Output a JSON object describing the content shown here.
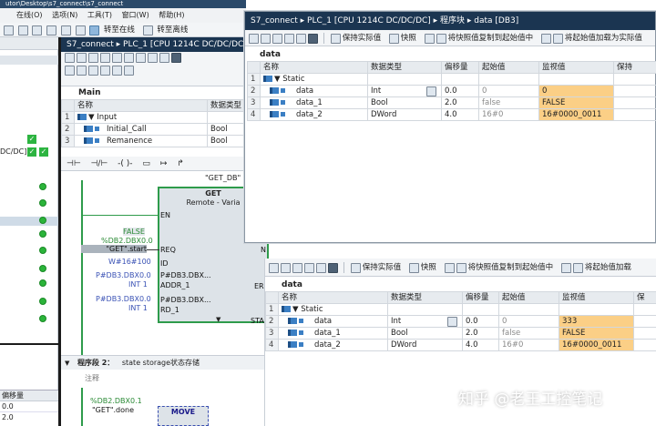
{
  "main_window": {
    "path_text": "utor\\Desktop\\s7_connect\\s7_connect",
    "menu": [
      "在线(O)",
      "选项(N)",
      "工具(T)",
      "窗口(W)",
      "帮助(H)"
    ],
    "toolbar_buttons": [
      "转至在线",
      "转至离线",
      "转至"
    ],
    "breadcrumb": "S7_connect ▸ PLC_1 [CPU 1214C DC/DC/DC]",
    "left_device_label": "DC/DC]",
    "block_title": "Main",
    "interface_headers": [
      "名称",
      "数据类型"
    ],
    "interface_rows": [
      {
        "num": "1",
        "name": "▼ Input",
        "type": ""
      },
      {
        "num": "2",
        "name": "Initial_Call",
        "type": "Bool"
      },
      {
        "num": "3",
        "name": "Remanence",
        "type": "Bool"
      }
    ],
    "lad_symbols": [
      "⊣⊢",
      "⊣/⊢",
      "-( )-",
      "▭",
      "↦",
      "↱"
    ],
    "get_block": {
      "instance": "\"GET_DB\"",
      "name": "GET",
      "subtitle": "Remote - Varia",
      "en": "EN",
      "req_value": "FALSE",
      "req_addr": "%DB2.DBX0.0",
      "req_tag": "\"GET\".start",
      "req": "REQ",
      "id_value": "W#16#100",
      "id": "ID",
      "addr_ptr": "P#DB3.DBX0.0",
      "addr_ptr2": "P#DB3.DBX...",
      "addr_type": "INT 1",
      "addr": "ADDR_1",
      "rd_ptr": "P#DB3.DBX0.0",
      "rd_ptr2": "P#DB3.DBX...",
      "rd_type": "INT 1",
      "rd": "RD_1",
      "err": "ERI",
      "sta": "STA",
      "n_out": "N"
    },
    "network2": {
      "title": "程序段 2：",
      "comment_text": "state storage状态存储",
      "comment_placeholder": "注释",
      "done_addr": "%DB2.DBX0.1",
      "done_tag": "\"GET\".done",
      "move": "MOVE"
    },
    "bottom_left_headers": [
      "偏移量"
    ],
    "bottom_left_values": [
      "0.0",
      "2.0"
    ]
  },
  "db_window_1": {
    "title": "S7_connect ▸ PLC_1 [CPU 1214C DC/DC/DC] ▸ 程序块 ▸ data [DB3]",
    "toolbar": [
      "保持实际值",
      "快照",
      "将快照值复制到起始值中",
      "将起始值加载为实际值"
    ],
    "db_name": "data",
    "headers": [
      "名称",
      "数据类型",
      "偏移量",
      "起始值",
      "监视值",
      "保持"
    ],
    "rows": [
      {
        "num": "1",
        "name": "▼ Static",
        "type": "",
        "offset": "",
        "start": "",
        "monitor": ""
      },
      {
        "num": "2",
        "name": "data",
        "type": "Int",
        "offset": "0.0",
        "start": "0",
        "monitor": "0"
      },
      {
        "num": "3",
        "name": "data_1",
        "type": "Bool",
        "offset": "2.0",
        "start": "false",
        "monitor": "FALSE"
      },
      {
        "num": "4",
        "name": "data_2",
        "type": "DWord",
        "offset": "4.0",
        "start": "16#0",
        "monitor": "16#0000_0011"
      }
    ]
  },
  "db_window_2": {
    "toolbar": [
      "保持实际值",
      "快照",
      "将快照值复制到起始值中",
      "将起始值加载"
    ],
    "db_name": "data",
    "headers": [
      "名称",
      "数据类型",
      "偏移量",
      "起始值",
      "监视值",
      "保"
    ],
    "rows": [
      {
        "num": "1",
        "name": "▼ Static",
        "type": "",
        "offset": "",
        "start": "",
        "monitor": ""
      },
      {
        "num": "2",
        "name": "data",
        "type": "Int",
        "offset": "0.0",
        "start": "0",
        "monitor": "333"
      },
      {
        "num": "3",
        "name": "data_1",
        "type": "Bool",
        "offset": "2.0",
        "start": "false",
        "monitor": "FALSE"
      },
      {
        "num": "4",
        "name": "data_2",
        "type": "DWord",
        "offset": "4.0",
        "start": "16#0",
        "monitor": "16#0000_0011"
      }
    ]
  },
  "watermark": "知乎 @老王工控笔记",
  "colors": {
    "title_bar": "#1b3551",
    "monitor_cell": "#fbcf86",
    "status_green": "#2bb43a",
    "fb_border": "#2e9b4b"
  }
}
